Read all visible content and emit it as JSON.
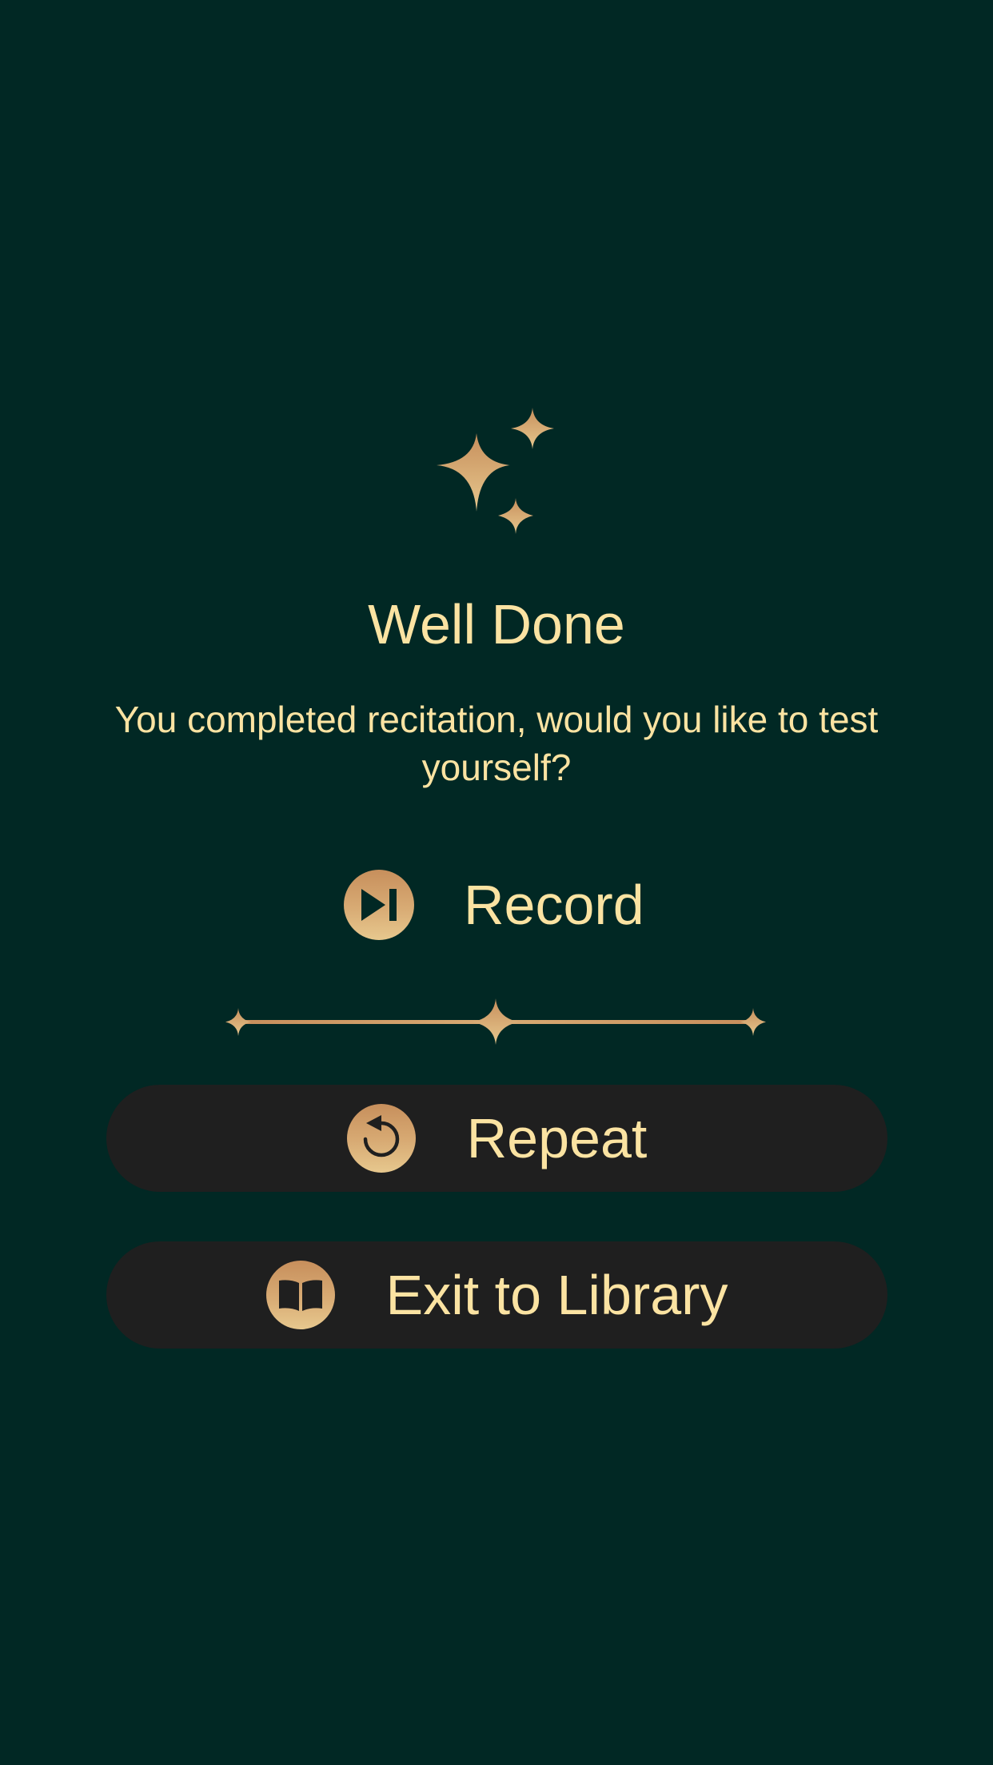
{
  "dialog": {
    "title": "Well Done",
    "message": "You completed recitation, would you like to test yourself?"
  },
  "actions": {
    "record_label": "Record",
    "repeat_label": "Repeat",
    "exit_label": "Exit to Library"
  },
  "icons": {
    "header": "sparkles-icon",
    "record": "play-next-icon",
    "repeat": "rotate-left-icon",
    "exit": "open-book-icon",
    "divider": "star-divider"
  },
  "colors": {
    "background": "#012824",
    "text": "#FBE3A2",
    "accent_gold_dark": "#C78F5C",
    "accent_gold_light": "#E7C88E",
    "button_background": "#1F1F1F"
  }
}
